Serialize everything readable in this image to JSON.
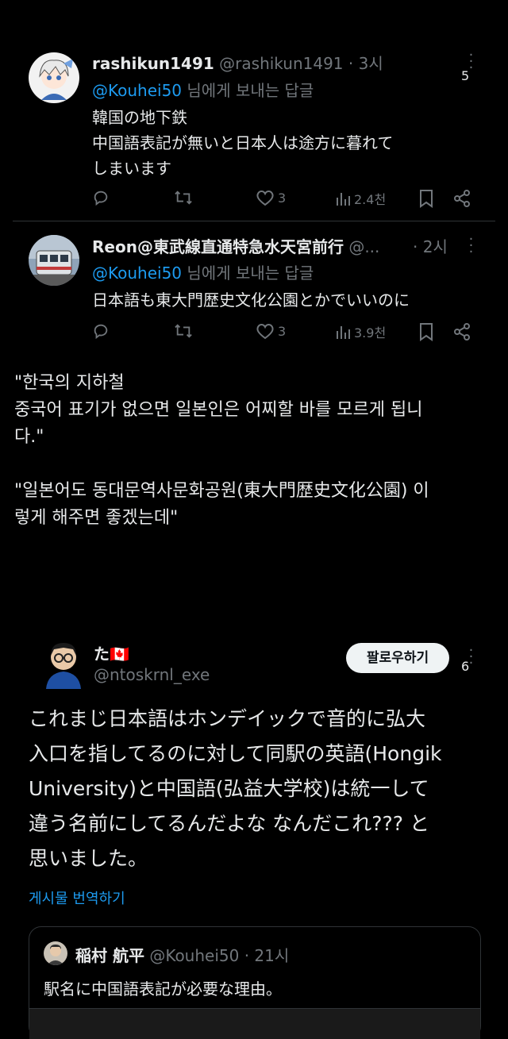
{
  "tweet1": {
    "display_name": "rashikun1491",
    "handle": "@rashikun1491",
    "time": "· 3시",
    "reply_mention": "@Kouhei50",
    "reply_rest": "님에게 보내는 답글",
    "lines": [
      "韓国の地下鉄",
      "中国語表記が無いと日本人は途方に暮れて",
      "しまいます"
    ],
    "likes": "3",
    "views": "2.4천",
    "marker": "5"
  },
  "tweet2": {
    "display_name": "Reon@東武線直通特急水天宮前行",
    "handle": "@...",
    "time": "· 2시",
    "reply_mention": "@Kouhei50",
    "reply_rest": "님에게 보내는 답글",
    "text": "日本語も東大門歴史文化公園とかでいいのに",
    "likes": "3",
    "views": "3.9천"
  },
  "translation": {
    "lines": [
      "\"한국의 지하철",
      "중국어 표기가 없으면 일본인은 어찌할 바를 모르게 됩니",
      "다.\"",
      "",
      "\"일본어도 동대문역사문화공원(東大門歴史文化公園) 이",
      "렇게 해주면 좋겠는데\""
    ]
  },
  "tweet3": {
    "display_name": "た🇨🇦",
    "handle": "@ntoskrnl_exe",
    "follow_label": "팔로우하기",
    "marker": "6",
    "lines": [
      "これまじ日本語はホンデイックで音的に弘大",
      "入口を指してるのに対して同駅の英語(Hongik",
      "University)と中国語(弘益大学校)は統一して",
      "違う名前にしてるんだよな  なんだこれ??? と",
      "思いました。"
    ],
    "translate_label": "게시물 번역하기"
  },
  "quote": {
    "display_name": "稲村 航平",
    "handle": "@Kouhei50",
    "time": "· 21시",
    "text": "駅名に中国語表記が必要な理由。"
  },
  "colors": {
    "background": "#000000",
    "text": "#e7e9ea",
    "muted": "#71767b",
    "accent": "#1d9bf0",
    "divider": "#2f3336",
    "follow_bg": "#eff3f4"
  },
  "icons": [
    "reply-icon",
    "retweet-icon",
    "heart-icon",
    "views-icon",
    "bookmark-icon",
    "share-icon",
    "more-icon"
  ]
}
